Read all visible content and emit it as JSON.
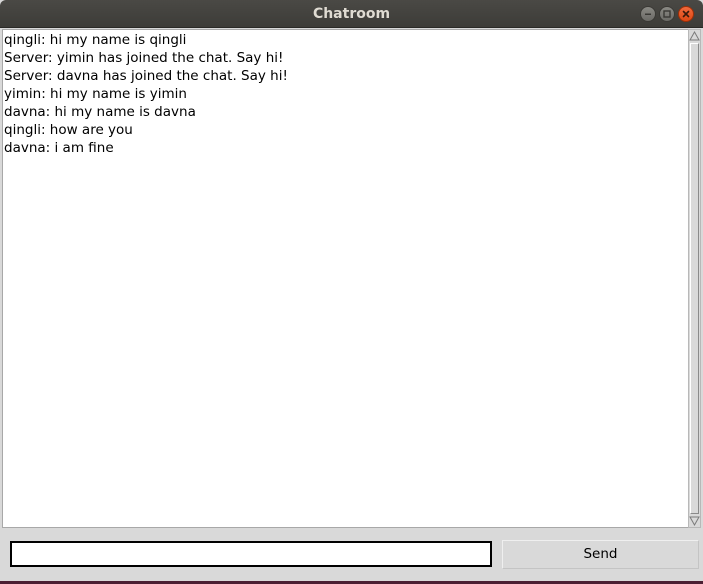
{
  "window": {
    "title": "Chatroom"
  },
  "titlebar_buttons": {
    "minimize_icon": "minimize-icon",
    "maximize_icon": "maximize-icon",
    "close_icon": "close-icon",
    "close_color": "#dd4814"
  },
  "chat": {
    "messages": [
      "qingli: hi my name is qingli",
      "Server: yimin has joined the chat. Say hi!",
      "Server: davna has joined the chat. Say hi!",
      "yimin: hi my name is yimin",
      "davna: hi my name is davna",
      "qingli: how are you",
      "davna: i am fine"
    ]
  },
  "compose": {
    "value": "",
    "send_label": "Send"
  }
}
